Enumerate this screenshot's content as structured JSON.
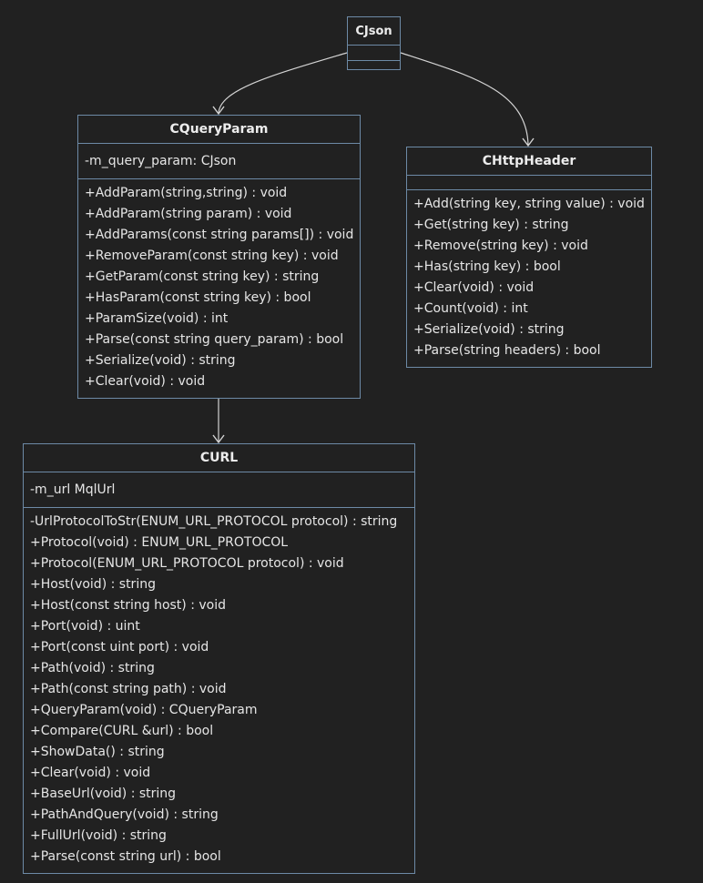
{
  "diagram": {
    "type": "class-diagram",
    "theme_colors": {
      "background": "#212121",
      "border": "#6d8aa6",
      "text": "#e6e6e6",
      "edge": "#d4d4d4"
    },
    "classes": {
      "cjson": {
        "name": "CJson",
        "attributes": [],
        "methods": []
      },
      "cqueryparam": {
        "name": "CQueryParam",
        "attributes": [
          "-m_query_param: CJson"
        ],
        "methods": [
          "+AddParam(string,string) : void",
          "+AddParam(string param) : void",
          "+AddParams(const string params[]) : void",
          "+RemoveParam(const string key) : void",
          "+GetParam(const string key) : string",
          "+HasParam(const string key) : bool",
          "+ParamSize(void) : int",
          "+Parse(const string query_param) : bool",
          "+Serialize(void) : string",
          "+Clear(void) : void"
        ]
      },
      "chttpheader": {
        "name": "CHttpHeader",
        "attributes": [],
        "methods": [
          "+Add(string key, string value) : void",
          "+Get(string key) : string",
          "+Remove(string key) : void",
          "+Has(string key) : bool",
          "+Clear(void) : void",
          "+Count(void) : int",
          "+Serialize(void) : string",
          "+Parse(string headers) : bool"
        ]
      },
      "curl": {
        "name": "CURL",
        "attributes": [
          "-m_url MqlUrl"
        ],
        "methods": [
          "-UrlProtocolToStr(ENUM_URL_PROTOCOL protocol) : string",
          "+Protocol(void) : ENUM_URL_PROTOCOL",
          "+Protocol(ENUM_URL_PROTOCOL protocol) : void",
          "+Host(void) : string",
          "+Host(const string host) : void",
          "+Port(void) : uint",
          "+Port(const uint port) : void",
          "+Path(void) : string",
          "+Path(const string path) : void",
          "+QueryParam(void) : CQueryParam",
          "+Compare(CURL &url) : bool",
          "+ShowData() : string",
          "+Clear(void) : void",
          "+BaseUrl(void) : string",
          "+PathAndQuery(void) : string",
          "+FullUrl(void) : string",
          "+Parse(const string url) : bool"
        ]
      }
    },
    "relations": [
      {
        "from": "CJson",
        "to": "CQueryParam",
        "type": "association",
        "arrow": "open"
      },
      {
        "from": "CJson",
        "to": "CHttpHeader",
        "type": "association",
        "arrow": "open"
      },
      {
        "from": "CQueryParam",
        "to": "CURL",
        "type": "association",
        "arrow": "open"
      }
    ]
  }
}
